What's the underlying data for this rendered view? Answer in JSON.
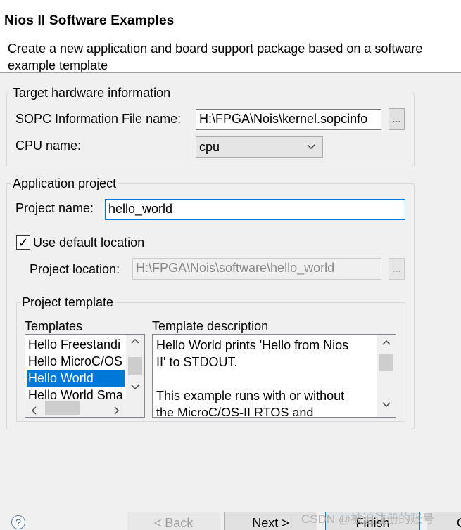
{
  "header": {
    "title": "Nios II Software Examples",
    "description": "Create a new application and board support package based on a software example template"
  },
  "target_hardware": {
    "legend": "Target hardware information",
    "sopc_label": "SOPC Information File name:",
    "sopc_value": "H:\\FPGA\\Nois\\kernel.sopcinfo",
    "browse_label": "...",
    "cpu_label": "CPU name:",
    "cpu_value": "cpu"
  },
  "application_project": {
    "legend": "Application project",
    "project_name_label": "Project name:",
    "project_name_value": "hello_world",
    "use_default_location_label": "Use default location",
    "use_default_location_checked": true,
    "checkbox_mark": "✓",
    "project_location_label": "Project location:",
    "project_location_value": "H:\\FPGA\\Nois\\software\\hello_world",
    "browse_label": "..."
  },
  "project_template": {
    "legend": "Project template",
    "templates_header": "Templates",
    "templates": [
      {
        "label": "Hello Freestandi",
        "selected": false
      },
      {
        "label": "Hello MicroC/OS",
        "selected": false
      },
      {
        "label": "Hello World",
        "selected": true
      },
      {
        "label": "Hello World Sma",
        "selected": false
      }
    ],
    "description_header": "Template description",
    "description_lines": [
      "Hello World prints 'Hello from Nios",
      "II' to STDOUT.",
      "",
      "This example runs with or without",
      "the MicroC/OS-II RTOS and"
    ]
  },
  "footer": {
    "help_label": "?",
    "back_label": "< Back",
    "next_label": "Next >",
    "finish_label": "Finish",
    "cancel_label": "C"
  },
  "watermark": "CSDN @被迫注册的账号",
  "colors": {
    "accent": "#0078d7",
    "background": "#f0f0f0",
    "header_bg": "#ffffff"
  }
}
